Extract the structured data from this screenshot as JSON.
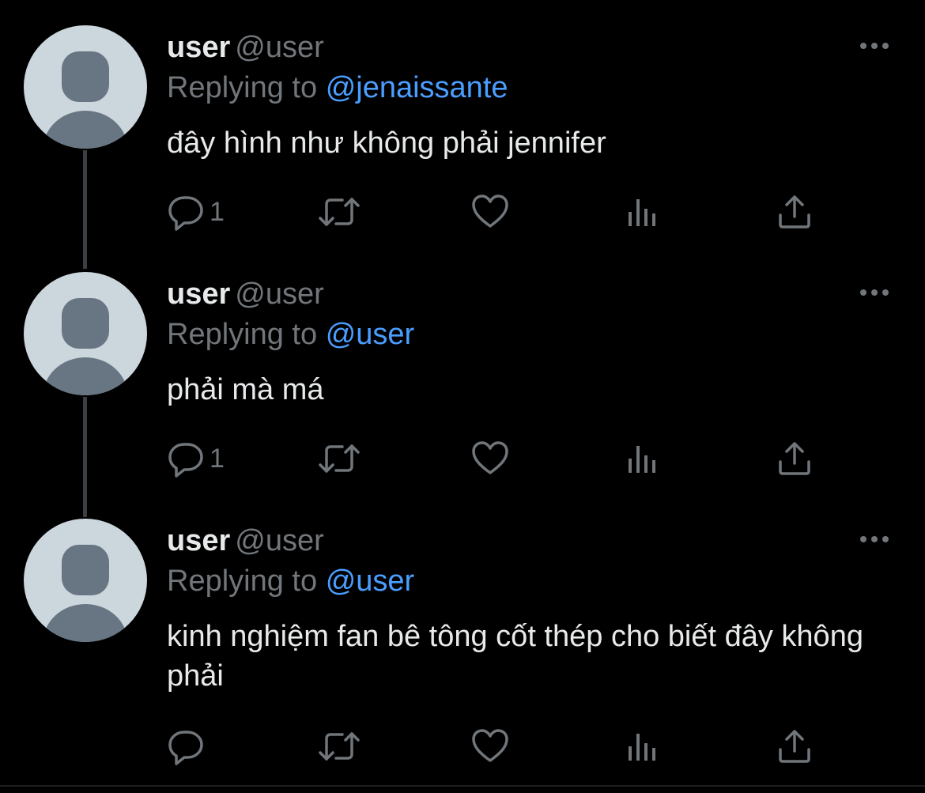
{
  "colors": {
    "background": "#000000",
    "text_primary": "#e7e9ea",
    "text_secondary": "#71767b",
    "mention": "#4a9eff",
    "avatar_bg": "#ccd6dd",
    "avatar_fg": "#687684"
  },
  "icons": {
    "reply": "speech-bubble-icon",
    "retweet": "retweet-arrows-icon",
    "like": "heart-icon",
    "views": "bar-chart-icon",
    "share": "upload-icon",
    "more": "ellipsis-icon"
  },
  "tweets": [
    {
      "name": "user",
      "handle": "@user",
      "replying_label": "Replying to",
      "replying_to": "@jenaissante",
      "text": "đây hình như không phải jennifer",
      "reply_count": "1"
    },
    {
      "name": "user",
      "handle": "@user",
      "replying_label": "Replying to",
      "replying_to": "@user",
      "text": "phải mà má",
      "reply_count": "1"
    },
    {
      "name": "user",
      "handle": "@user",
      "replying_label": "Replying to",
      "replying_to": "@user",
      "text": "kinh nghiệm fan bê tông cốt thép cho biết đây không phải",
      "reply_count": ""
    }
  ]
}
